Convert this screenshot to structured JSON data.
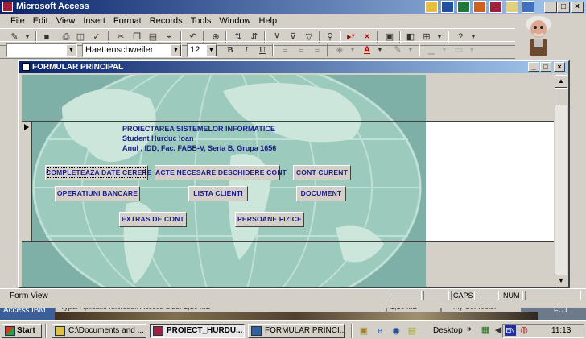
{
  "app": {
    "title": "Microsoft Access",
    "caption_buttons": [
      "_",
      "□",
      "×"
    ]
  },
  "menu": [
    "File",
    "Edit",
    "View",
    "Insert",
    "Format",
    "Records",
    "Tools",
    "Window",
    "Help"
  ],
  "formatting": {
    "font_name": "Haettenschweiler",
    "font_size": "12",
    "bold": "B",
    "italic": "I",
    "underline": "U"
  },
  "child_window": {
    "title": "FORMULAR PRINCIPAL"
  },
  "form": {
    "info_lines": [
      "PROIECTAREA SISTEMELOR INFORMATICE",
      "Student Hurduc Ioan",
      "Anul , IDD, Fac. FABB-V, Seria B, Grupa 1656"
    ],
    "buttons": {
      "completeaza": "COMPLETEAZA DATE CERERE",
      "acte": "ACTE NECESARE DESCHIDERE CONT",
      "cont_curent": "CONT CURENT",
      "operatiuni": "OPERATIUNI BANCARE",
      "lista_clienti": "LISTA CLIENTI",
      "document": "DOCUMENT",
      "extras": "EXTRAS DE CONT",
      "persoane": "PERSOANE FIZICE"
    }
  },
  "status": {
    "view": "Form View",
    "caps": "CAPS",
    "num": "NUM"
  },
  "background_window": {
    "left_label": "Access IBM",
    "text": "Type: Aplicatie Microsoft Access Size: 1,10 MB",
    "size": "1,10 MB",
    "location": "My Computer",
    "right_label": "FOT..."
  },
  "taskbar": {
    "start": "Start",
    "items": [
      "C:\\Documents and ...",
      "PROIECT_HURDU...",
      "FORMULAR PRINCI..."
    ],
    "desktop": "Desktop",
    "lang": "EN",
    "time": "11:13"
  },
  "colors": {
    "titlebar_start": "#0a246a",
    "form_bg": "#7fb0a8",
    "button_text": "#1a1a8c"
  }
}
